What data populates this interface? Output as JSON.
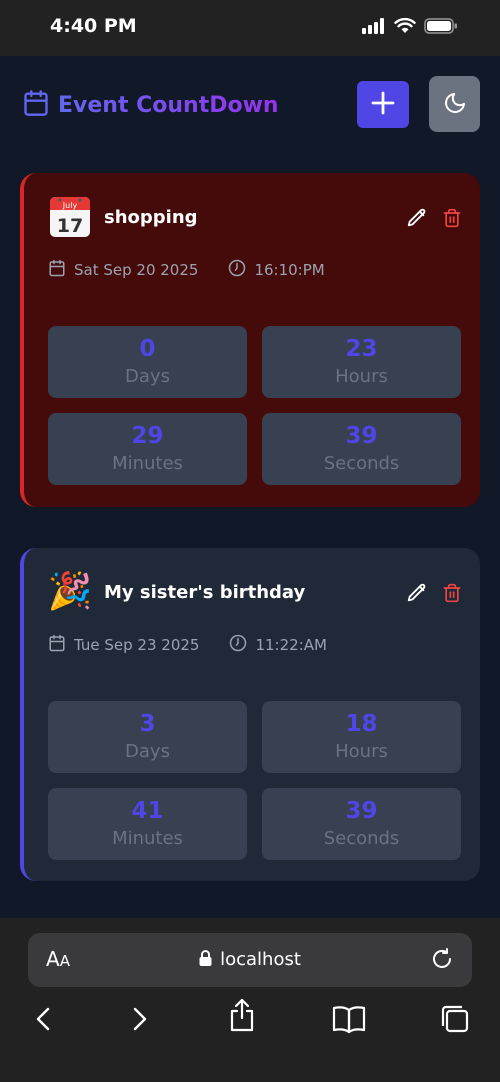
{
  "status_bar": {
    "time": "4:40 PM"
  },
  "header": {
    "title": "Event CountDown",
    "icons": {
      "calendar": "calendar-icon",
      "add": "plus-icon",
      "theme": "moon-icon"
    }
  },
  "colors": {
    "accent": "#4f46e5",
    "overdue_border": "#dc2626",
    "overdue_bg": "#450a0a",
    "card_bg": "#1f2937",
    "page_bg": "#111827"
  },
  "events": [
    {
      "emoji": "📅",
      "emoji_month": "July",
      "emoji_day": "17",
      "title": "shopping",
      "date": "Sat Sep 20 2025",
      "time": "16:10:PM",
      "days": "0",
      "days_label": "Days",
      "hours": "23",
      "hours_label": "Hours",
      "minutes": "29",
      "minutes_label": "Minutes",
      "seconds": "39",
      "seconds_label": "Seconds"
    },
    {
      "emoji": "🎉",
      "title": "My sister's birthday",
      "date": "Tue Sep 23 2025",
      "time": "11:22:AM",
      "days": "3",
      "days_label": "Days",
      "hours": "18",
      "hours_label": "Hours",
      "minutes": "41",
      "minutes_label": "Minutes",
      "seconds": "39",
      "seconds_label": "Seconds"
    }
  ],
  "browser": {
    "aa_big": "A",
    "aa_small": "A",
    "url": "localhost"
  }
}
